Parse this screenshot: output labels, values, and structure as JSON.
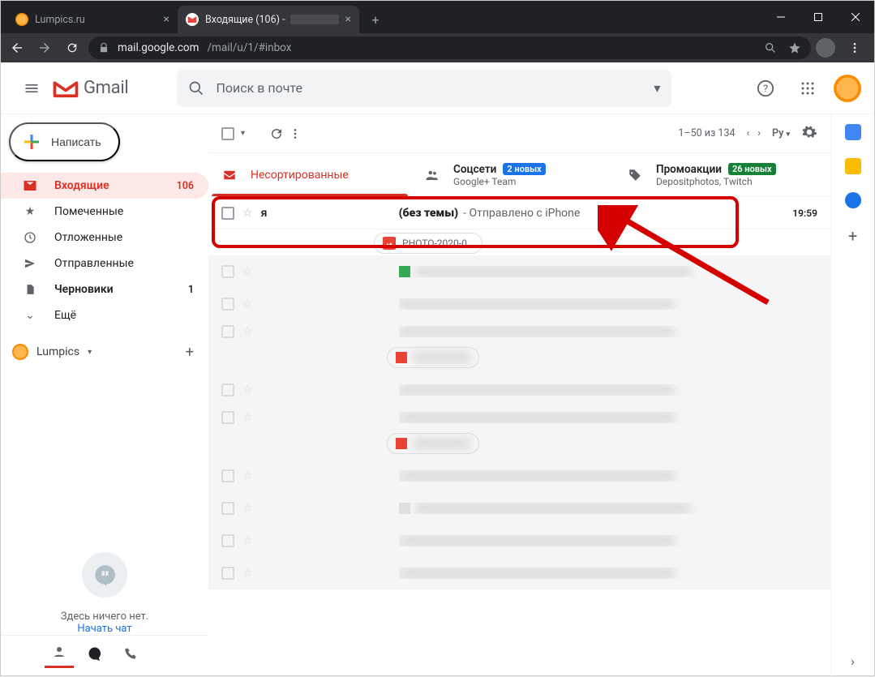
{
  "browser": {
    "tab1": {
      "title": "Lumpics.ru"
    },
    "tab2": {
      "title": "Входящие (106) -"
    },
    "url_host": "mail.google.com",
    "url_path": "/mail/u/1/#inbox"
  },
  "header": {
    "product": "Gmail",
    "search_placeholder": "Поиск в почте"
  },
  "compose": {
    "label": "Написать"
  },
  "sidebar": {
    "items": [
      {
        "label": "Входящие",
        "count": "106"
      },
      {
        "label": "Помеченные"
      },
      {
        "label": "Отложенные"
      },
      {
        "label": "Отправленные"
      },
      {
        "label": "Черновики",
        "count": "1"
      },
      {
        "label": "Ещё"
      }
    ],
    "account_label": "Lumpics"
  },
  "hangouts": {
    "empty": "Здесь ничего нет.",
    "start": "Начать чат"
  },
  "toolbar": {
    "range": "1–50 из 134",
    "lang": "Py"
  },
  "tabs": {
    "primary": {
      "label": "Несортированные"
    },
    "social": {
      "label": "Соцсети",
      "badge": "2 новых",
      "sub": "Google+ Team"
    },
    "promo": {
      "label": "Промоакции",
      "badge": "26 новых",
      "sub": "Depositphotos, Twitch"
    }
  },
  "message": {
    "sender": "я",
    "subject": "(без темы)",
    "snippet": " - Отправлено с iPhone",
    "time": "19:59",
    "attachment": "PHOTO-2020-0…"
  }
}
